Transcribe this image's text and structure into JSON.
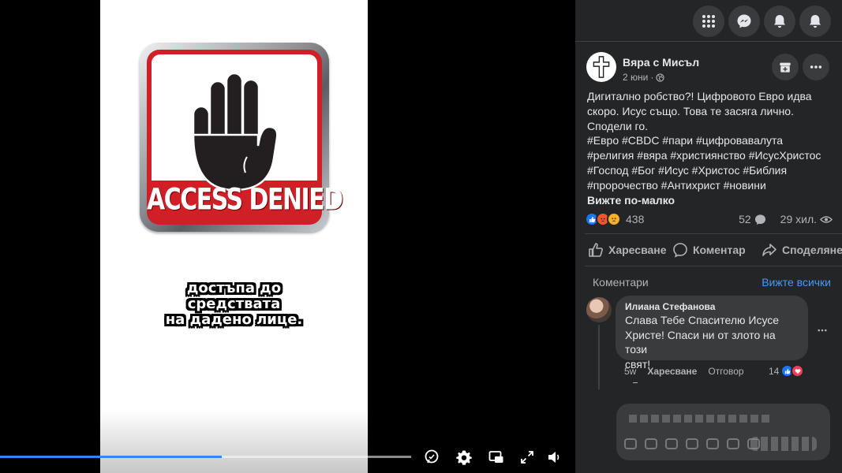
{
  "video": {
    "sign_text": "ACCESS DENIED",
    "caption_lines": [
      "достъпа до",
      "средствата",
      "на дадено лице."
    ],
    "progress": {
      "played": 0.54,
      "buffered": 0.54
    },
    "controls": [
      "captions-icon",
      "settings-icon",
      "picture-in-picture-icon",
      "fullscreen-icon",
      "volume-icon"
    ]
  },
  "topbar": {
    "buttons": [
      "menu-grid-icon",
      "messenger-icon",
      "notifications-icon",
      "account-icon"
    ]
  },
  "post": {
    "page_name": "Вяра с Мисъл",
    "date": "2 юни",
    "separator": "·",
    "body_lines": [
      "Дигитално робство?! Цифровото Евро идва",
      "скоро. Исус също. Това те засяга лично.",
      "Сподели го."
    ],
    "hashtag_lines": [
      "#Евро #CBDC #пари #цифровавалута",
      "#религия #вяра #християнство #ИсусХристос",
      "#Господ #Бог #Исус #Христос #Библия",
      "#пророчество #Антихрист #новини"
    ],
    "see_less": "Вижте по-малко",
    "reaction_count": "438",
    "comment_count": "52",
    "views": "29 хил.",
    "actions": {
      "like": "Харесване",
      "comment": "Коментар",
      "share": "Споделяне"
    }
  },
  "comments": {
    "title": "Коментари",
    "see_all": "Вижте всички",
    "items": [
      {
        "author": "Илиана Стефанова",
        "text_lines": [
          "Слава Тебе Спасителю Исусе",
          "Христе! Спаси ни от злото на този",
          "свят!"
        ],
        "time": "5w",
        "like": "Харесване",
        "reply": "Отговор",
        "reactions": "14"
      }
    ]
  },
  "colors": {
    "panel_bg": "#242526",
    "surface": "#3a3b3c",
    "text_primary": "#e4e6eb",
    "text_secondary": "#b0b3b8",
    "link_blue": "#4599ff",
    "progress_blue": "#2d88ff",
    "sign_red": "#d01f27"
  }
}
